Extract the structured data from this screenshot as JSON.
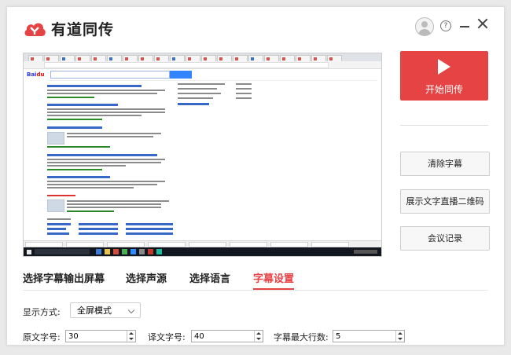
{
  "app": {
    "title": "有道同传"
  },
  "header": {
    "help_glyph": "?"
  },
  "actions": {
    "start_label": "开始同传",
    "clear_label": "清除字幕",
    "qr_label": "展示文字直播二维码",
    "records_label": "会议记录"
  },
  "tabs": [
    {
      "label": "选择字幕输出屏幕"
    },
    {
      "label": "选择声源"
    },
    {
      "label": "选择语言"
    },
    {
      "label": "字幕设置",
      "active": true
    }
  ],
  "settings": {
    "display_mode_label": "显示方式:",
    "display_mode_value": "全屏模式",
    "source_font_label": "原文字号:",
    "source_font_value": "30",
    "target_font_label": "译文字号:",
    "target_font_value": "40",
    "max_lines_label": "字幕最大行数:",
    "max_lines_value": "5"
  },
  "colors": {
    "accent": "#e64345"
  }
}
